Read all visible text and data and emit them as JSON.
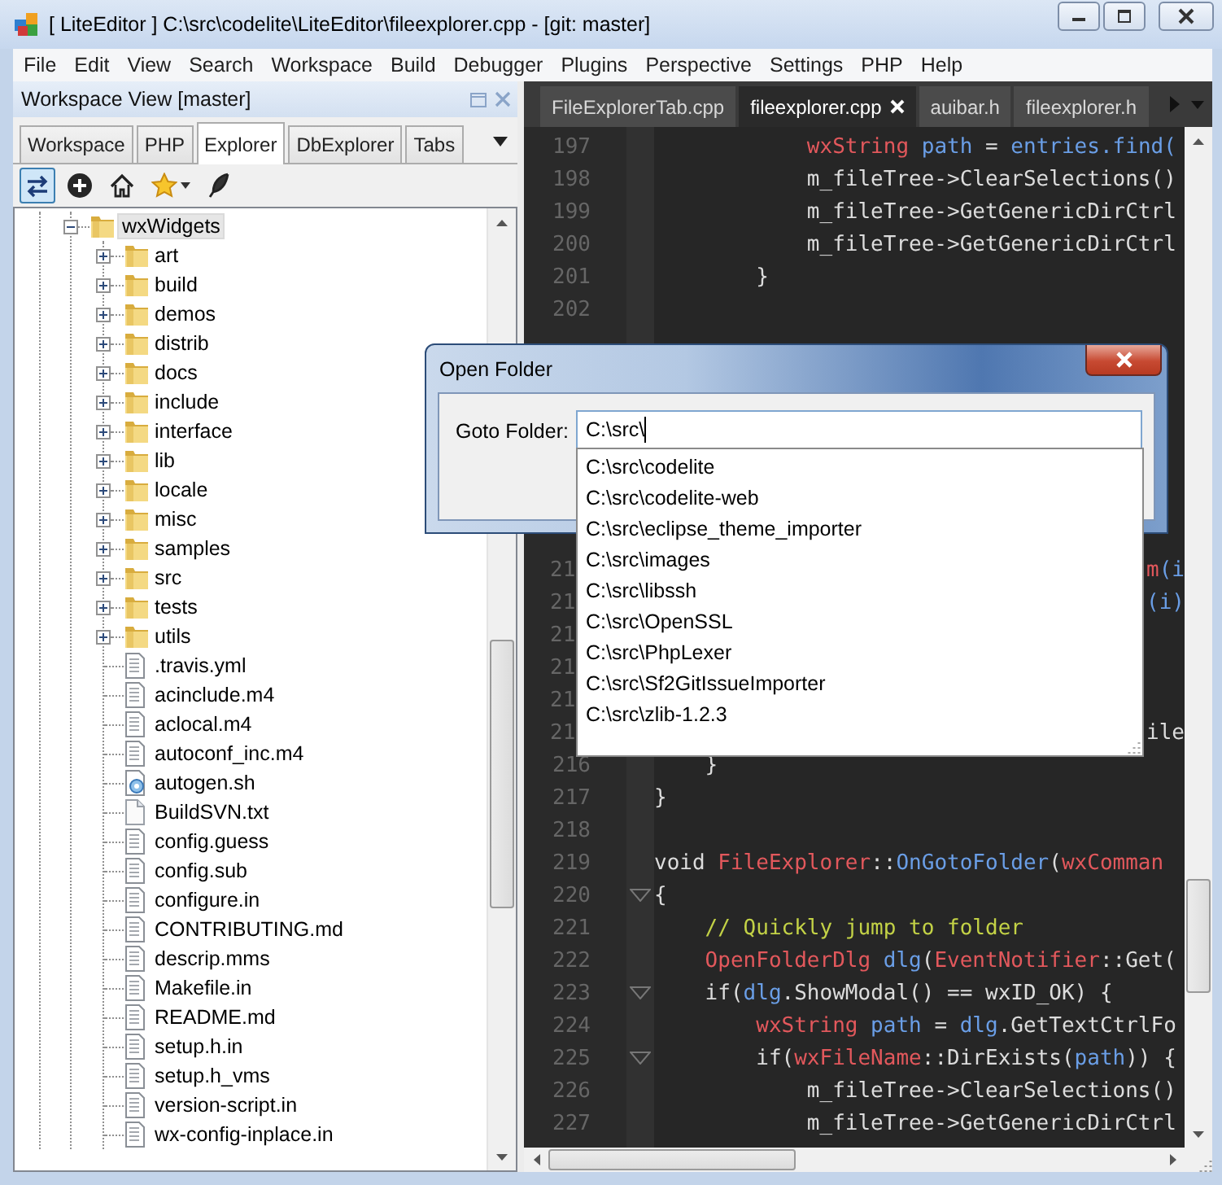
{
  "window": {
    "title": "[ LiteEditor ] C:\\src\\codelite\\LiteEditor\\fileexplorer.cpp - [git: master]"
  },
  "menu": [
    "File",
    "Edit",
    "View",
    "Search",
    "Workspace",
    "Build",
    "Debugger",
    "Plugins",
    "Perspective",
    "Settings",
    "PHP",
    "Help"
  ],
  "workspace_view": {
    "title": "Workspace View [master]",
    "tabs": [
      {
        "label": "Workspace",
        "selected": false
      },
      {
        "label": "PHP",
        "selected": false
      },
      {
        "label": "Explorer",
        "selected": true
      },
      {
        "label": "DbExplorer",
        "selected": false
      },
      {
        "label": "Tabs",
        "selected": false
      }
    ],
    "toolbar": [
      {
        "kind": "sync",
        "selected": true
      },
      {
        "kind": "add",
        "selected": false
      },
      {
        "kind": "home",
        "selected": false
      },
      {
        "kind": "star",
        "selected": false
      },
      {
        "kind": "feather",
        "selected": false
      }
    ],
    "tree": {
      "label": "wxWidgets",
      "kind": "folder",
      "expanded": true,
      "selected": true,
      "children": [
        {
          "label": "art",
          "kind": "folder",
          "expanded": false,
          "selected": false
        },
        {
          "label": "build",
          "kind": "folder",
          "expanded": false,
          "selected": false
        },
        {
          "label": "demos",
          "kind": "folder",
          "expanded": false,
          "selected": false
        },
        {
          "label": "distrib",
          "kind": "folder",
          "expanded": false,
          "selected": false
        },
        {
          "label": "docs",
          "kind": "folder",
          "expanded": false,
          "selected": false
        },
        {
          "label": "include",
          "kind": "folder",
          "expanded": false,
          "selected": false
        },
        {
          "label": "interface",
          "kind": "folder",
          "expanded": false,
          "selected": false
        },
        {
          "label": "lib",
          "kind": "folder",
          "expanded": false,
          "selected": false
        },
        {
          "label": "locale",
          "kind": "folder",
          "expanded": false,
          "selected": false
        },
        {
          "label": "misc",
          "kind": "folder",
          "expanded": false,
          "selected": false
        },
        {
          "label": "samples",
          "kind": "folder",
          "expanded": false,
          "selected": false
        },
        {
          "label": "src",
          "kind": "folder",
          "expanded": false,
          "selected": false
        },
        {
          "label": "tests",
          "kind": "folder",
          "expanded": false,
          "selected": false
        },
        {
          "label": "utils",
          "kind": "folder",
          "expanded": false,
          "selected": false
        },
        {
          "label": ".travis.yml",
          "kind": "file",
          "selected": false
        },
        {
          "label": "acinclude.m4",
          "kind": "file",
          "selected": false
        },
        {
          "label": "aclocal.m4",
          "kind": "file",
          "selected": false
        },
        {
          "label": "autoconf_inc.m4",
          "kind": "file",
          "selected": false
        },
        {
          "label": "autogen.sh",
          "kind": "script",
          "selected": false
        },
        {
          "label": "BuildSVN.txt",
          "kind": "blank",
          "selected": false
        },
        {
          "label": "config.guess",
          "kind": "file",
          "selected": false
        },
        {
          "label": "config.sub",
          "kind": "file",
          "selected": false
        },
        {
          "label": "configure.in",
          "kind": "file",
          "selected": false
        },
        {
          "label": "CONTRIBUTING.md",
          "kind": "file",
          "selected": false
        },
        {
          "label": "descrip.mms",
          "kind": "file",
          "selected": false
        },
        {
          "label": "Makefile.in",
          "kind": "file",
          "selected": false
        },
        {
          "label": "README.md",
          "kind": "file",
          "selected": false
        },
        {
          "label": "setup.h.in",
          "kind": "file",
          "selected": false
        },
        {
          "label": "setup.h_vms",
          "kind": "file",
          "selected": false
        },
        {
          "label": "version-script.in",
          "kind": "file",
          "selected": false
        },
        {
          "label": "wx-config-inplace.in",
          "kind": "file",
          "selected": false
        }
      ]
    }
  },
  "editor": {
    "tabs": [
      {
        "label": "FileExplorerTab.cpp",
        "selected": false
      },
      {
        "label": "fileexplorer.cpp",
        "selected": true
      },
      {
        "label": "auibar.h",
        "selected": false
      },
      {
        "label": "fileexplorer.h",
        "selected": false
      }
    ],
    "lines_above_dialog": [
      {
        "number": "197",
        "tokens": [
          {
            "text": "            wxString",
            "kind": "type"
          },
          {
            "text": " path",
            "kind": "ident"
          },
          {
            "text": " = ",
            "kind": "plain"
          },
          {
            "text": "entries.find(",
            "kind": "ident"
          }
        ]
      },
      {
        "number": "198",
        "tokens": [
          {
            "text": "            m_fileTree->ClearSelections()",
            "kind": "plain"
          }
        ]
      },
      {
        "number": "199",
        "tokens": [
          {
            "text": "            m_fileTree->GetGenericDirCtrl",
            "kind": "plain"
          }
        ]
      },
      {
        "number": "200",
        "tokens": [
          {
            "text": "            m_fileTree->GetGenericDirCtrl",
            "kind": "plain"
          }
        ]
      },
      {
        "number": "201",
        "tokens": [
          {
            "text": "        }",
            "kind": "plain"
          }
        ]
      },
      {
        "number": "202"
      }
    ],
    "lines_beside_list": [
      {
        "number": "21",
        "tail": [
          {
            "text": "m",
            "kind": "type"
          },
          {
            "text": "(i",
            "kind": "ident"
          }
        ]
      },
      {
        "number": "21",
        "tail": [
          {
            "text": "(i)",
            "kind": "ident"
          }
        ]
      },
      {
        "number": "21"
      },
      {
        "number": "21"
      },
      {
        "number": "21"
      },
      {
        "number": "21",
        "tail": [
          {
            "text": "ile",
            "kind": "plain"
          }
        ]
      }
    ],
    "lines_below_list": [
      {
        "number": "216",
        "tokens": [
          {
            "text": "    }",
            "kind": "plain"
          }
        ]
      },
      {
        "number": "217",
        "tokens": [
          {
            "text": "}",
            "kind": "plain"
          }
        ]
      },
      {
        "number": "218"
      },
      {
        "number": "219",
        "tokens": [
          {
            "text": "void ",
            "kind": "plain"
          },
          {
            "text": "FileExplorer",
            "kind": "type"
          },
          {
            "text": "::",
            "kind": "plain"
          },
          {
            "text": "OnGotoFolder",
            "kind": "ident"
          },
          {
            "text": "(",
            "kind": "plain"
          },
          {
            "text": "wxComman",
            "kind": "type"
          }
        ]
      },
      {
        "number": "220",
        "fold": true,
        "tokens": [
          {
            "text": "{",
            "kind": "plain"
          }
        ]
      },
      {
        "number": "221",
        "tokens": [
          {
            "text": "    // Quickly jump to folder",
            "kind": "comment"
          }
        ]
      },
      {
        "number": "222",
        "tokens": [
          {
            "text": "    OpenFolderDlg",
            "kind": "type"
          },
          {
            "text": " dlg",
            "kind": "ident"
          },
          {
            "text": "(",
            "kind": "plain"
          },
          {
            "text": "EventNotifier",
            "kind": "type"
          },
          {
            "text": "::Get(",
            "kind": "plain"
          }
        ]
      },
      {
        "number": "223",
        "fold": true,
        "tokens": [
          {
            "text": "    if(",
            "kind": "plain"
          },
          {
            "text": "dlg",
            "kind": "ident"
          },
          {
            "text": ".ShowModal() == wxID_OK) {",
            "kind": "plain"
          }
        ]
      },
      {
        "number": "224",
        "tokens": [
          {
            "text": "        wxString",
            "kind": "type"
          },
          {
            "text": " path",
            "kind": "ident"
          },
          {
            "text": " = ",
            "kind": "plain"
          },
          {
            "text": "dlg",
            "kind": "ident"
          },
          {
            "text": ".GetTextCtrlFo",
            "kind": "plain"
          }
        ]
      },
      {
        "number": "225",
        "fold": true,
        "tokens": [
          {
            "text": "        if(",
            "kind": "plain"
          },
          {
            "text": "wxFileName",
            "kind": "type"
          },
          {
            "text": "::DirExists(",
            "kind": "plain"
          },
          {
            "text": "path",
            "kind": "ident"
          },
          {
            "text": ")) {",
            "kind": "plain"
          }
        ]
      },
      {
        "number": "226",
        "tokens": [
          {
            "text": "            m_fileTree->ClearSelections()",
            "kind": "plain"
          }
        ]
      },
      {
        "number": "227",
        "tokens": [
          {
            "text": "            m_fileTree->GetGenericDirCtrl",
            "kind": "plain"
          }
        ]
      }
    ]
  },
  "dialog": {
    "title": "Open Folder",
    "label": "Goto Folder:",
    "value": "C:\\src\\",
    "suggestions": [
      {
        "label": "C:\\src\\codelite",
        "selected": false
      },
      {
        "label": "C:\\src\\codelite-web",
        "selected": false
      },
      {
        "label": "C:\\src\\eclipse_theme_importer",
        "selected": false
      },
      {
        "label": "C:\\src\\images",
        "selected": false
      },
      {
        "label": "C:\\src\\libssh",
        "selected": false
      },
      {
        "label": "C:\\src\\OpenSSL",
        "selected": false
      },
      {
        "label": "C:\\src\\PhpLexer",
        "selected": false
      },
      {
        "label": "C:\\src\\Sf2GitIssueImporter",
        "selected": false
      },
      {
        "label": "C:\\src\\zlib-1.2.3",
        "selected": false
      }
    ]
  }
}
